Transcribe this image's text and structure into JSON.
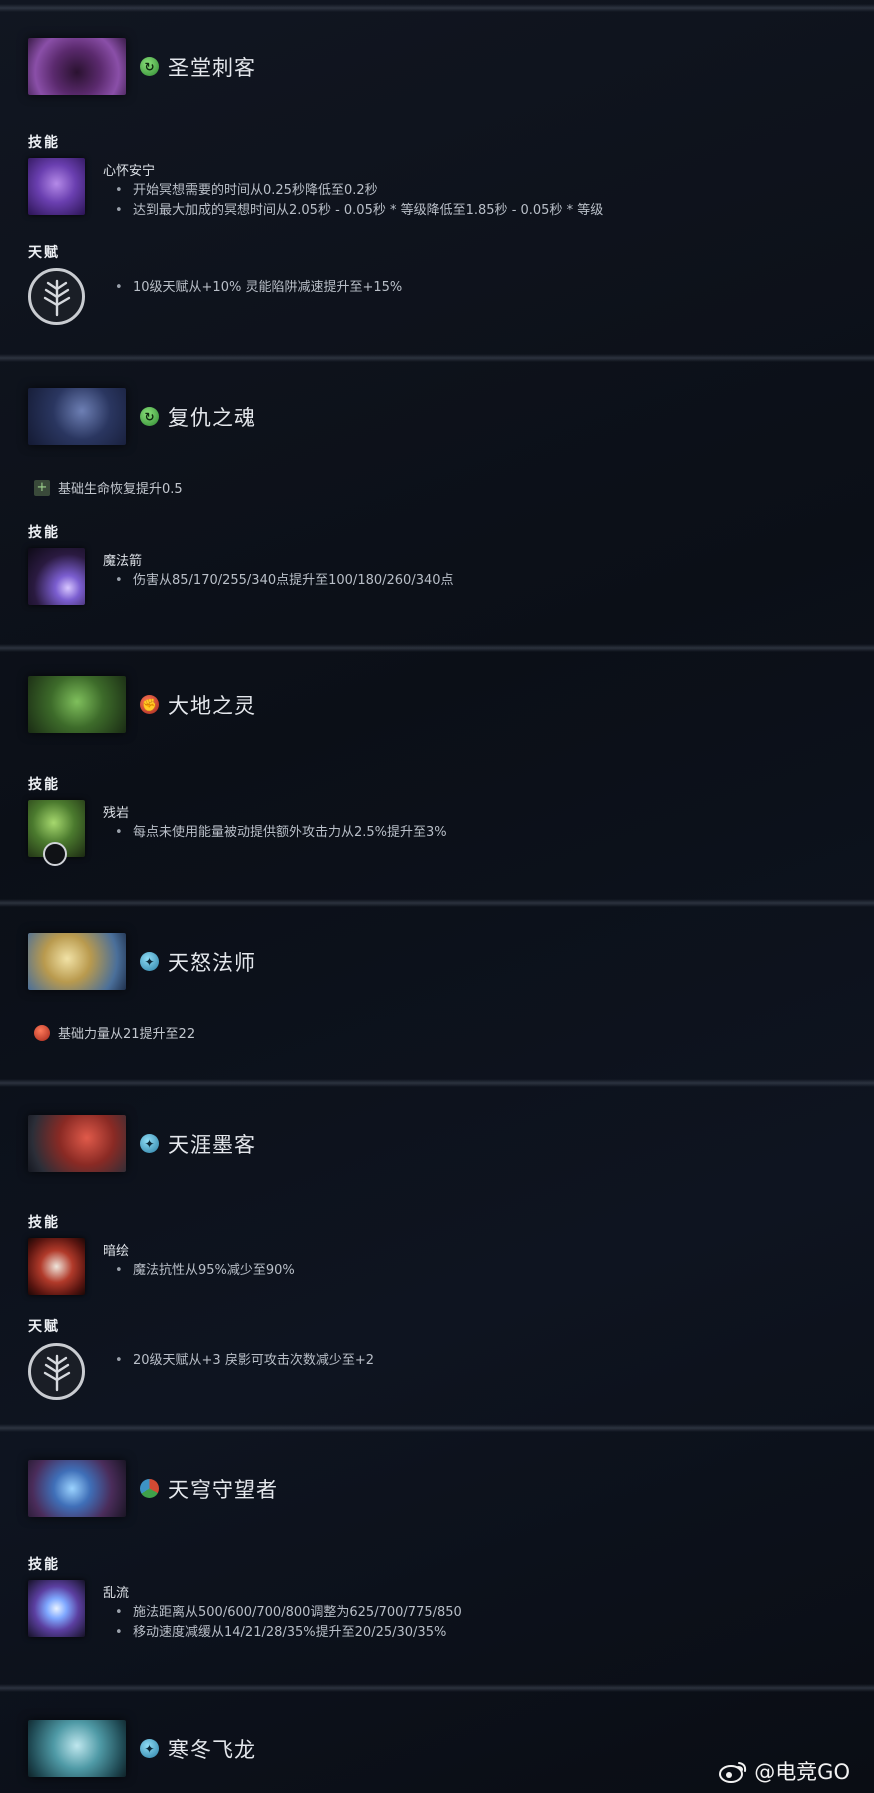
{
  "heroes": [
    {
      "name": "圣堂刺客",
      "attr": "agi",
      "ability_label": "技能",
      "ability_name": "心怀安宁",
      "ability_bullets": [
        "开始冥想需要的时间从0.25秒降低至0.2秒",
        "达到最大加成的冥想时间从2.05秒 - 0.05秒 * 等级降低至1.85秒 - 0.05秒 * 等级"
      ],
      "talent_label": "天赋",
      "talent_bullets": [
        "10级天赋从+10% 灵能陷阱减速提升至+15%"
      ]
    },
    {
      "name": "复仇之魂",
      "attr": "agi",
      "base_note": "基础生命恢复提升0.5",
      "ability_label": "技能",
      "ability_name": "魔法箭",
      "ability_bullets": [
        "伤害从85/170/255/340点提升至100/180/260/340点"
      ]
    },
    {
      "name": "大地之灵",
      "attr": "str",
      "ability_label": "技能",
      "ability_name": "残岩",
      "ability_bullets": [
        "每点未使用能量被动提供额外攻击力从2.5%提升至3%"
      ]
    },
    {
      "name": "天怒法师",
      "attr": "int",
      "base_note": "基础力量从21提升至22"
    },
    {
      "name": "天涯墨客",
      "attr": "int",
      "ability_label": "技能",
      "ability_name": "暗绘",
      "ability_bullets": [
        "魔法抗性从95%减少至90%"
      ],
      "talent_label": "天赋",
      "talent_bullets": [
        "20级天赋从+3 戾影可攻击次数减少至+2"
      ]
    },
    {
      "name": "天穹守望者",
      "attr": "uni",
      "ability_label": "技能",
      "ability_name": "乱流",
      "ability_bullets": [
        "施法距离从500/600/700/800调整为625/700/775/850",
        "移动速度减缓从14/21/28/35%提升至20/25/30/35%"
      ]
    },
    {
      "name": "寒冬飞龙",
      "attr": "int"
    }
  ],
  "watermark": "@电竞GO",
  "colors": {
    "agi": "#3fa14a",
    "str": "#d24a33",
    "int": "#3d93c4",
    "bg": "#0d1119"
  }
}
